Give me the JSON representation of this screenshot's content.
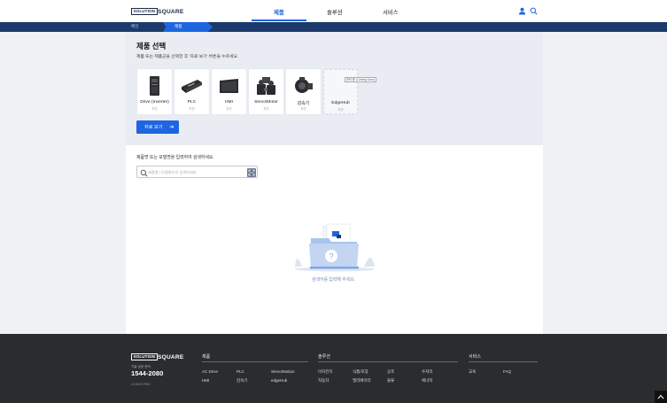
{
  "header": {
    "logo_box": "SOLUTION",
    "logo_text": "SQUARE",
    "nav": [
      {
        "label": "제품",
        "active": true
      },
      {
        "label": "솔루션",
        "active": false
      },
      {
        "label": "서비스",
        "active": false
      }
    ]
  },
  "breadcrumb": {
    "home": "메인",
    "current": "제품"
  },
  "selection": {
    "title": "제품 선택",
    "subtitle": "제품 또는 제품군을 선택한 후 '자료 보기' 버튼을 누르세요.",
    "cards": [
      {
        "name": "Drive (Inverter)",
        "count": "추천"
      },
      {
        "name": "PLC",
        "count": "추천"
      },
      {
        "name": "HMI",
        "count": "추천"
      },
      {
        "name": "Servo/Motor",
        "count": "추천"
      },
      {
        "name": "감속기",
        "count": "추천"
      },
      {
        "name": "EdgeHub",
        "count": "추천",
        "badge": "준비 중 (Coming Soon)"
      }
    ],
    "view_button": "자료 보기"
  },
  "search": {
    "hint": "제품명 또는 모델명을 입력하여 검색하세요.",
    "placeholder": "제품명 / 모델명으로 검색하세요"
  },
  "empty_state": {
    "text": "검색어를 입력해 주세요."
  },
  "footer": {
    "logo_box": "SOLUTION",
    "logo_text": "SQUARE",
    "phone_label": "기술 상담 문의",
    "phone": "1544-2080",
    "hours": "LS ELECTRIC",
    "columns": [
      {
        "title": "제품",
        "links": [
          "AC Drive",
          "PLC",
          "Servo/Motion",
          "HMI",
          "감속기",
          "edgeHub"
        ]
      },
      {
        "title": "솔루션",
        "links": [
          "이차전지",
          "식품/포장",
          "공조",
          "수처리",
          "자동차",
          "엘리베이터",
          "물류",
          "에너지"
        ]
      },
      {
        "title": "서비스",
        "links": [
          "교육",
          "FAQ"
        ]
      }
    ]
  },
  "colors": {
    "accent": "#1e66e0",
    "navy": "#1b3a6b",
    "footer": "#2b2c2f"
  }
}
